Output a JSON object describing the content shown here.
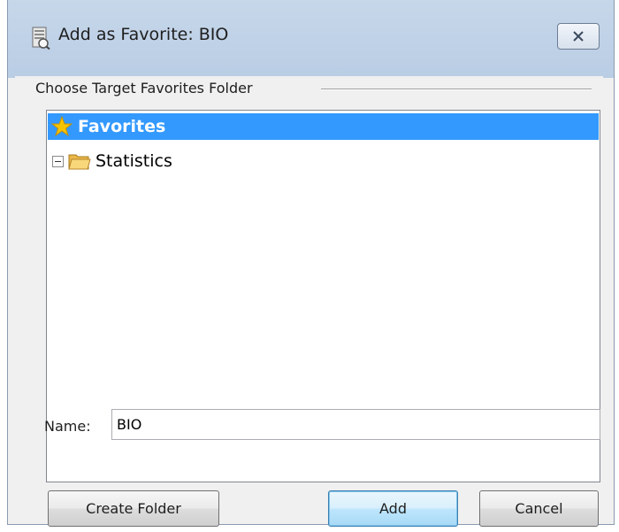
{
  "window": {
    "title": "Add as Favorite: BIO",
    "title_icon": "favorites-database-icon",
    "close_icon": "close-icon"
  },
  "group": {
    "label": "Choose Target Favorites Folder"
  },
  "tree": {
    "items": [
      {
        "label": "Favorites",
        "icon": "star-icon",
        "selected": true
      },
      {
        "label": "Statistics",
        "icon": "folder-icon",
        "expander": "collapse-minus-icon",
        "selected": false
      }
    ]
  },
  "name_field": {
    "label": "Name:",
    "value": "BIO"
  },
  "buttons": {
    "create_folder": "Create Folder",
    "add": "Add",
    "cancel": "Cancel"
  },
  "colors": {
    "selection": "#3399ff",
    "titlebar": "#bfd2e8",
    "star": "#f5c400"
  }
}
